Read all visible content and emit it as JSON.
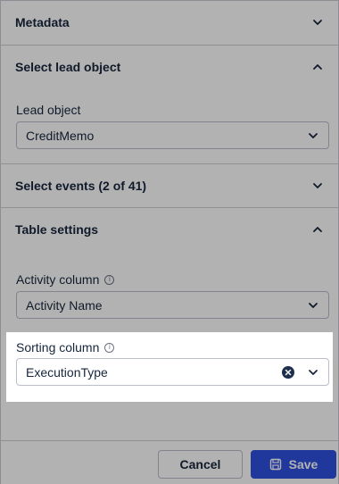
{
  "sections": {
    "metadata": {
      "title": "Metadata"
    },
    "lead_object_section": {
      "title": "Select lead object"
    },
    "events_section": {
      "title": "Select events (2 of 41)"
    },
    "table_settings": {
      "title": "Table settings"
    }
  },
  "lead_object": {
    "label": "Lead object",
    "value": "CreditMemo"
  },
  "activity_column": {
    "label": "Activity column",
    "value": "Activity Name"
  },
  "sorting_column": {
    "label": "Sorting column",
    "value": "ExecutionType"
  },
  "footer": {
    "cancel_label": "Cancel",
    "save_label": "Save"
  },
  "colors": {
    "primary": "#2f4fe0",
    "text": "#17263d",
    "overlay": "rgba(0,0,0,0.30)"
  },
  "icons": [
    "chevron-down-icon",
    "chevron-up-icon",
    "info-icon",
    "clear-icon",
    "save-icon"
  ]
}
